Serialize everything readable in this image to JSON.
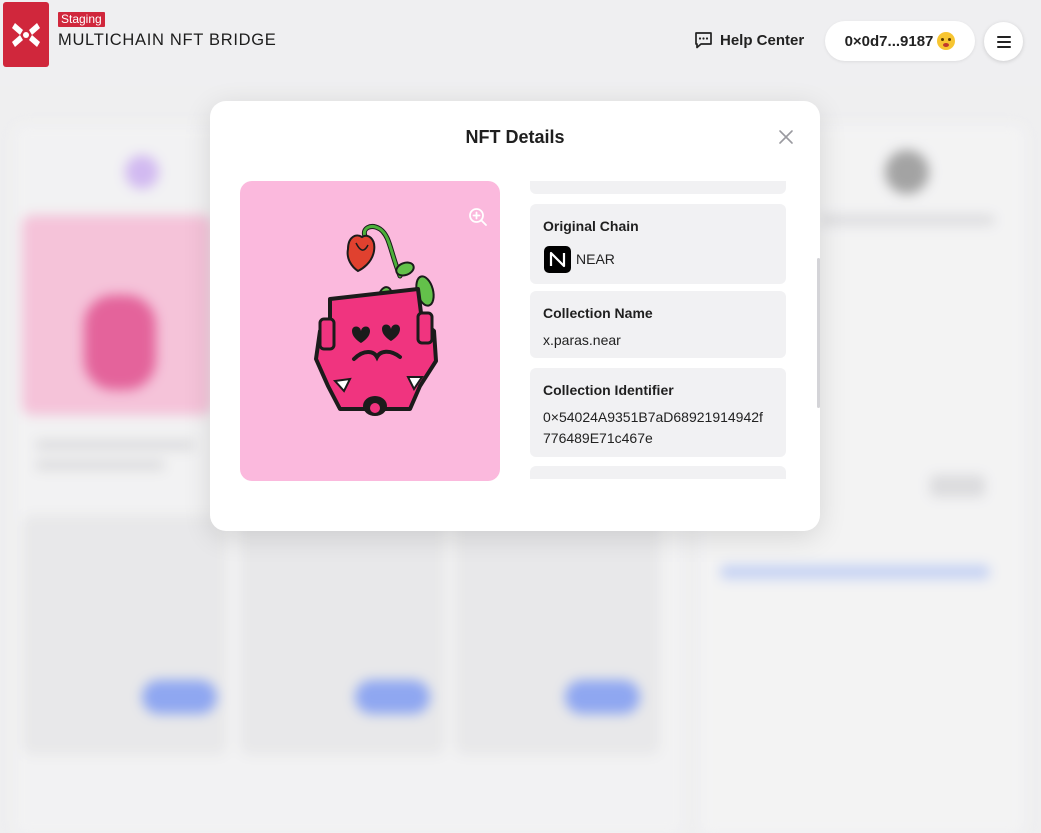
{
  "header": {
    "badge": "Staging",
    "app_name": "MULTICHAIN NFT BRIDGE",
    "help_label": "Help Center",
    "wallet_address": "0×0d7...9187"
  },
  "modal": {
    "title": "NFT Details",
    "details": [
      {
        "label": "Original Chain",
        "value": "NEAR"
      },
      {
        "label": "Collection Name",
        "value": "x.paras.near"
      },
      {
        "label": "Collection Identifier",
        "value_line1": "0×54024A9351B7aD68921914942f",
        "value_line2": "776489E71c467e"
      }
    ]
  },
  "colors": {
    "brand_red": "#d0273c",
    "nft_background": "#fbb9dd",
    "nft_body": "#f0347f"
  },
  "icons": [
    "logo-x-icon",
    "chat-icon",
    "wallet-emoji-icon",
    "menu-icon",
    "close-icon",
    "zoom-in-icon",
    "near-logo-icon"
  ]
}
